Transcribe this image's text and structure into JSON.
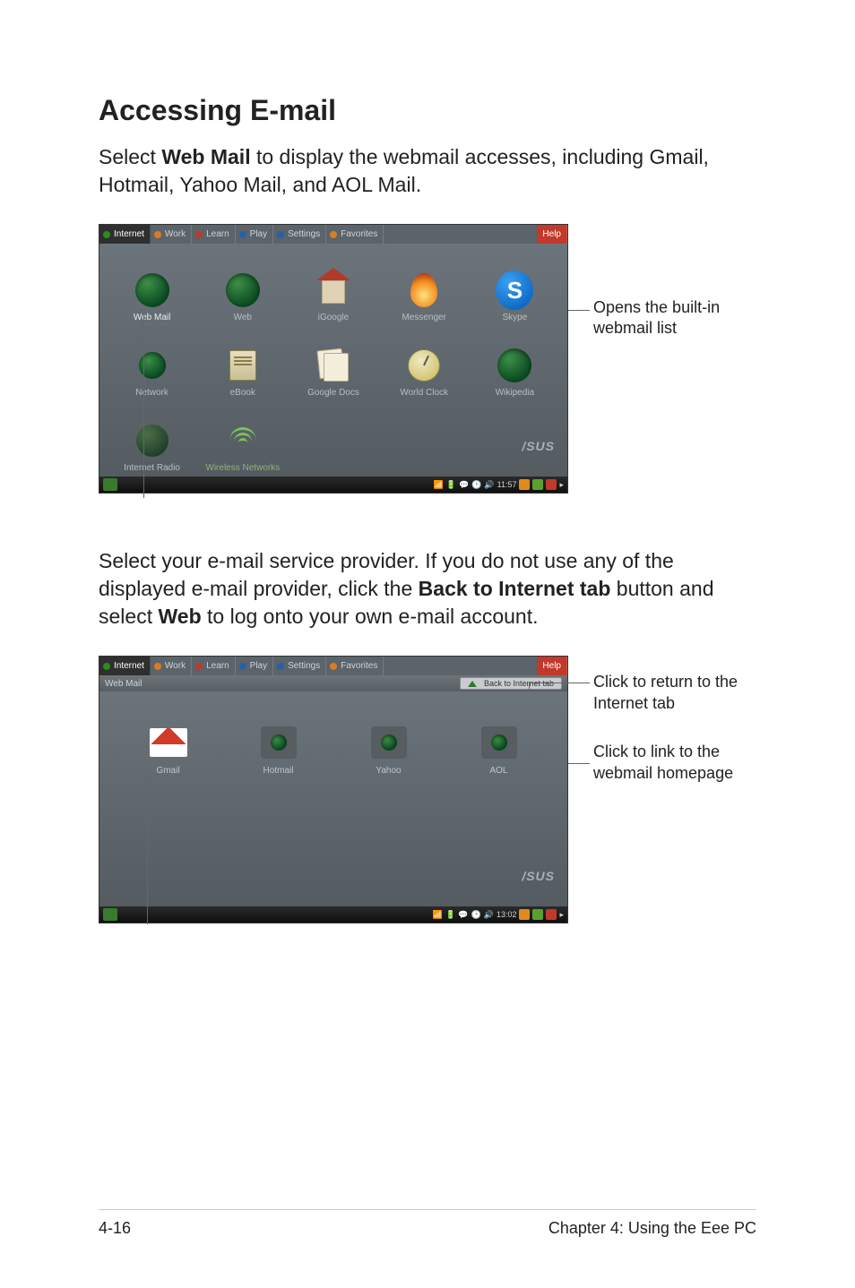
{
  "heading": "Accessing E-mail",
  "lead": {
    "p1a": "Select ",
    "bold1": "Web Mail",
    "p1b": " to display the webmail accesses, including Gmail, Hotmail, Yahoo Mail, and AOL Mail."
  },
  "para2": {
    "a": "Select your e-mail service provider. If you do not use any of the displayed e-mail provider, click the ",
    "bold1": "Back to Internet tab",
    "b": " button and select ",
    "bold2": "Web",
    "c": " to log onto your own e-mail account."
  },
  "tabs": {
    "internet": "Internet",
    "work": "Work",
    "learn": "Learn",
    "play": "Play",
    "settings": "Settings",
    "favorites": "Favorites",
    "help": "Help"
  },
  "apps1": {
    "webmail": "Web Mail",
    "web": "Web",
    "igoogle": "iGoogle",
    "messenger": "Messenger",
    "skype": "Skype",
    "network": "Network",
    "ebook": "eBook",
    "googledocs": "Google Docs",
    "worldclock": "World Clock",
    "wikipedia": "Wikipedia",
    "internetradio": "Internet Radio",
    "wirelessnetworks": "Wireless Networks"
  },
  "taskbar1_time": "11:57",
  "taskbar2_time": "13:02",
  "asuslogo": "/SUS",
  "callout1": "Opens the built-in webmail list",
  "webmail": {
    "subtitle": "Web Mail",
    "backbtn": "Back to Internet tab",
    "gmail": "Gmail",
    "hotmail": "Hotmail",
    "yahoo": "Yahoo",
    "aol": "AOL"
  },
  "callout2": "Click to return to the Internet tab",
  "callout3": "Click to link to the webmail homepage",
  "footer_left": "4-16",
  "footer_right": "Chapter 4: Using the Eee PC",
  "skype_letter": "S"
}
